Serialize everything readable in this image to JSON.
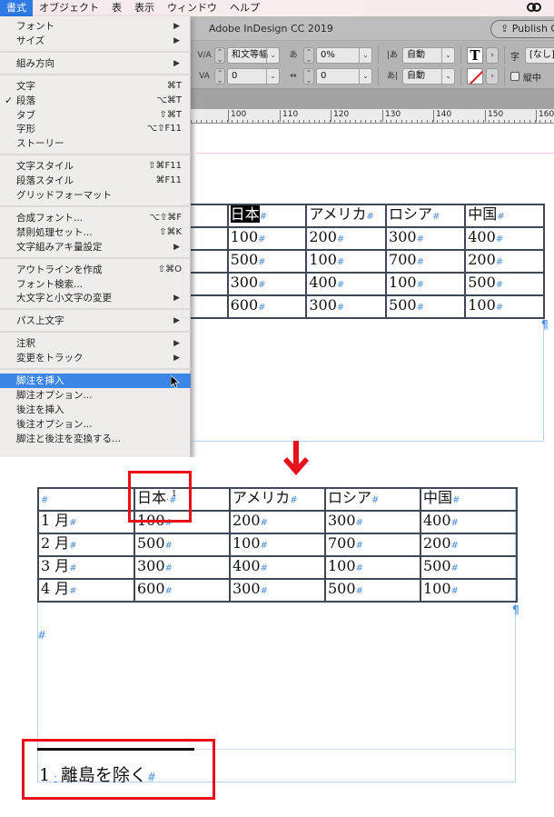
{
  "menubar": {
    "items": [
      "書式",
      "オブジェクト",
      "表",
      "表示",
      "ウィンドウ",
      "ヘルプ"
    ],
    "active_index": 0,
    "status_icon": "creative-cloud-icon"
  },
  "app": {
    "title": "Adobe InDesign CC 2019",
    "publish_button": "Publish Online"
  },
  "control_panel": {
    "mojikumi_value": "和文等幅",
    "tsume_value": "0%",
    "kerning_value": "0",
    "tracking_value": "0",
    "aki_before": "自動",
    "aki_after": "自動",
    "style_label": "字",
    "style_value": "[なし]",
    "tatechuyoko_label": "縦中"
  },
  "ruler": {
    "labels": [
      "100",
      "110",
      "120",
      "130",
      "140",
      "150",
      "160"
    ]
  },
  "format_menu": {
    "items": [
      {
        "label": "フォント",
        "submenu": true
      },
      {
        "label": "サイズ",
        "submenu": true
      },
      {
        "divider": true
      },
      {
        "label": "組み方向",
        "submenu": true
      },
      {
        "divider": true
      },
      {
        "label": "文字",
        "shortcut": "⌘T"
      },
      {
        "label": "段落",
        "shortcut": "⌥⌘T",
        "checked": true
      },
      {
        "label": "タブ",
        "shortcut": "⇧⌘T"
      },
      {
        "label": "字形",
        "shortcut": "⌥⇧F11"
      },
      {
        "label": "ストーリー"
      },
      {
        "divider": true
      },
      {
        "label": "文字スタイル",
        "shortcut": "⇧⌘F11"
      },
      {
        "label": "段落スタイル",
        "shortcut": "⌘F11"
      },
      {
        "label": "グリッドフォーマット"
      },
      {
        "divider": true
      },
      {
        "label": "合成フォント...",
        "shortcut": "⌥⇧⌘F"
      },
      {
        "label": "禁則処理セット...",
        "shortcut": "⇧⌘K"
      },
      {
        "label": "文字組みアキ量設定",
        "submenu": true
      },
      {
        "divider": true
      },
      {
        "label": "アウトラインを作成",
        "shortcut": "⇧⌘O"
      },
      {
        "label": "フォント検索..."
      },
      {
        "label": "大文字と小文字の変更",
        "submenu": true
      },
      {
        "divider": true
      },
      {
        "label": "パス上文字",
        "submenu": true
      },
      {
        "divider": true
      },
      {
        "label": "注釈",
        "submenu": true
      },
      {
        "label": "変更をトラック",
        "submenu": true
      },
      {
        "divider": true
      },
      {
        "label": "脚注を挿入",
        "highlighted": true
      },
      {
        "label": "脚注オプション..."
      },
      {
        "label": "後注を挿入"
      },
      {
        "label": "後注オプション..."
      },
      {
        "label": "脚注と後注を変換する..."
      }
    ]
  },
  "table_before": {
    "header": [
      "",
      "日本",
      "アメリカ",
      "ロシア",
      "中国"
    ],
    "selected_text": "日本",
    "rows": [
      [
        "",
        "100",
        "200",
        "300",
        "400"
      ],
      [
        "",
        "500",
        "100",
        "700",
        "200"
      ],
      [
        "",
        "300",
        "400",
        "100",
        "500"
      ],
      [
        "",
        "600",
        "300",
        "500",
        "100"
      ]
    ]
  },
  "table_after": {
    "header": [
      "",
      "日本",
      "アメリカ",
      "ロシア",
      "中国"
    ],
    "footnote_ref": "1",
    "rows": [
      [
        "1 月",
        "100",
        "200",
        "300",
        "400"
      ],
      [
        "2 月",
        "500",
        "100",
        "700",
        "200"
      ],
      [
        "3 月",
        "300",
        "400",
        "100",
        "500"
      ],
      [
        "4 月",
        "600",
        "300",
        "500",
        "100"
      ]
    ]
  },
  "footnote": {
    "number": "1",
    "separator": "·",
    "text": "離島を除く"
  },
  "marks": {
    "pilcrow": "#",
    "frame_end": "¶"
  },
  "colors": {
    "annotation_red": "#e8101a",
    "menu_highlight": "#3b86e6",
    "hidden_char_blue": "#4a90e2",
    "table_border": "#3f4856"
  }
}
